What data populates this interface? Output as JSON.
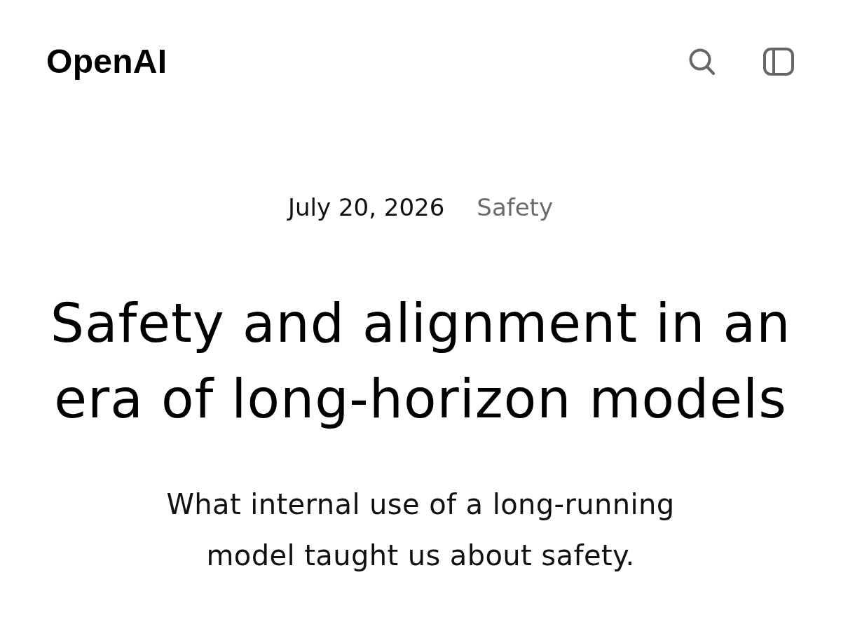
{
  "header": {
    "logo": "OpenAI"
  },
  "article": {
    "date": "July 20, 2026",
    "category": "Safety",
    "title": "Safety and alignment in an era of long-horizon models",
    "subtitle": "What internal use of a long-running model taught us about safety."
  }
}
